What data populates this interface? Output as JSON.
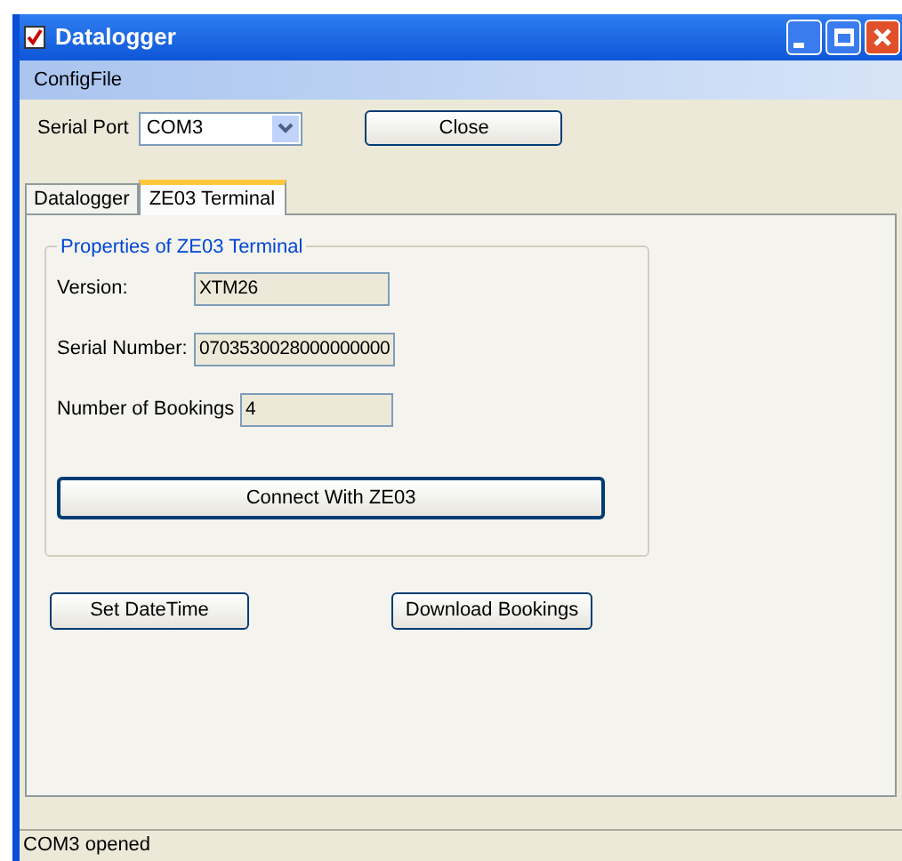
{
  "window": {
    "title": "Datalogger"
  },
  "menu": [
    "ConfigFile"
  ],
  "serial_port": {
    "label": "Serial Port",
    "value": "COM3"
  },
  "close_button": "Close",
  "tabs": [
    {
      "label": "Datalogger",
      "selected": false
    },
    {
      "label": "ZE03 Terminal",
      "selected": true
    }
  ],
  "group": {
    "title": "Properties of ZE03 Terminal",
    "fields": [
      {
        "label": "Version:",
        "value": "XTM26"
      },
      {
        "label": "Serial Number:",
        "value": "0703530028000000000"
      },
      {
        "label": "Number of Bookings",
        "value": "4"
      }
    ],
    "button": "Connect With ZE03"
  },
  "buttons": [
    "Set DateTime",
    "Download Bookings"
  ],
  "status_bar": "COM3 opened"
}
